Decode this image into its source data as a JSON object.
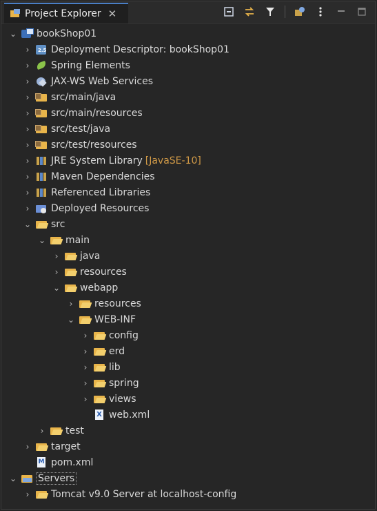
{
  "view": {
    "tab_title": "Project Explorer",
    "close_glyph": "✕"
  },
  "toolbar_icons": [
    "collapse-all-icon",
    "link-with-editor-icon",
    "filter-icon",
    "focus-icon",
    "view-menu-icon",
    "minimize-icon",
    "maximize-icon"
  ],
  "tree": [
    {
      "label": "bookShop01",
      "expanded": true,
      "icon": "project-icon"
    },
    {
      "label": "Deployment Descriptor: bookShop01",
      "icon": "deployment-descriptor-icon"
    },
    {
      "label": "Spring Elements",
      "icon": "spring-icon"
    },
    {
      "label": "JAX-WS Web Services",
      "icon": "web-services-icon"
    },
    {
      "label": "src/main/java",
      "icon": "source-folder-icon"
    },
    {
      "label": "src/main/resources",
      "icon": "source-folder-icon"
    },
    {
      "label": "src/test/java",
      "icon": "source-folder-icon"
    },
    {
      "label": "src/test/resources",
      "icon": "source-folder-icon"
    },
    {
      "label": "JRE System Library",
      "decoration": "[JavaSE-10]",
      "icon": "library-icon"
    },
    {
      "label": "Maven Dependencies",
      "icon": "library-icon"
    },
    {
      "label": "Referenced Libraries",
      "icon": "library-icon"
    },
    {
      "label": "Deployed Resources",
      "icon": "deployed-resources-icon"
    },
    {
      "label": "src",
      "expanded": true,
      "icon": "folder-icon"
    },
    {
      "label": "main",
      "expanded": true,
      "icon": "folder-icon"
    },
    {
      "label": "java",
      "icon": "folder-icon"
    },
    {
      "label": "resources",
      "icon": "folder-icon"
    },
    {
      "label": "webapp",
      "expanded": true,
      "icon": "folder-icon"
    },
    {
      "label": "resources",
      "icon": "folder-icon"
    },
    {
      "label": "WEB-INF",
      "expanded": true,
      "icon": "folder-icon"
    },
    {
      "label": "config",
      "icon": "folder-icon"
    },
    {
      "label": "erd",
      "icon": "folder-icon"
    },
    {
      "label": "lib",
      "icon": "folder-icon"
    },
    {
      "label": "spring",
      "icon": "folder-icon"
    },
    {
      "label": "views",
      "icon": "folder-icon"
    },
    {
      "label": "web.xml",
      "icon": "xml-file-icon"
    },
    {
      "label": "test",
      "icon": "folder-icon"
    },
    {
      "label": "target",
      "icon": "folder-icon"
    },
    {
      "label": "pom.xml",
      "icon": "maven-file-icon"
    },
    {
      "label": "Servers",
      "expanded": true,
      "selected": true,
      "icon": "servers-folder-icon"
    },
    {
      "label": "Tomcat v9.0 Server at localhost-config",
      "icon": "folder-icon"
    }
  ]
}
